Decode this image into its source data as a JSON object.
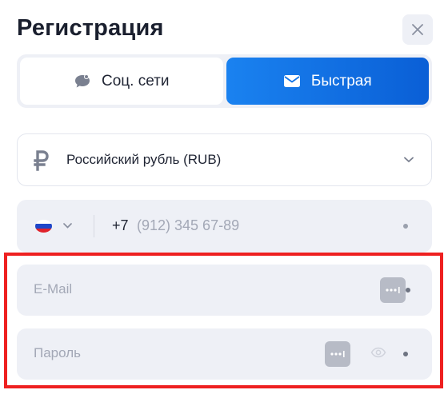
{
  "header": {
    "title": "Регистрация"
  },
  "tabs": [
    {
      "label": "Соц. сети",
      "icon": "chat-bubble-icon",
      "active": false
    },
    {
      "label": "Быстрая",
      "icon": "envelope-icon",
      "active": true
    }
  ],
  "currency": {
    "symbol": "₽",
    "label": "Российский рубль (RUB)"
  },
  "phone": {
    "country_code": "+7",
    "placeholder": "(912) 345 67-89"
  },
  "email": {
    "placeholder": "E-Mail"
  },
  "password": {
    "placeholder": "Пароль"
  },
  "colors": {
    "accent_gradient_start": "#1a82f0",
    "accent_gradient_end": "#0a5fd6",
    "field_bg": "#eef0f6",
    "highlight": "#ee2020"
  }
}
